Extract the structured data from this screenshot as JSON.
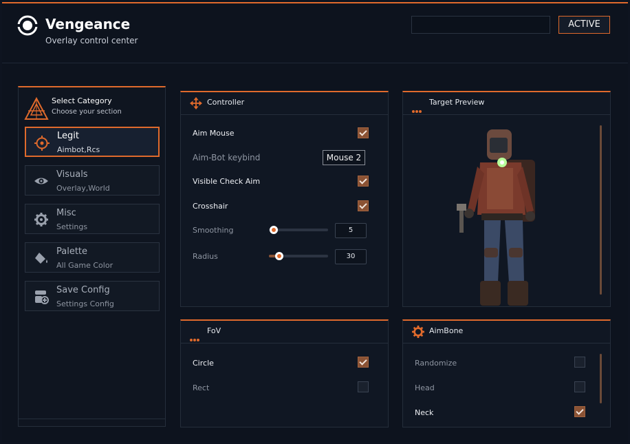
{
  "app": {
    "title": "Vengeance",
    "subtitle": "Overlay control center",
    "status": "ACTIVE",
    "accent": "#e06a2c"
  },
  "sidebar": {
    "title": "Select Category",
    "subtitle": "Choose your section",
    "items": [
      {
        "label": "Legit",
        "sub": "Aimbot,Rcs",
        "icon": "crosshair-icon",
        "active": true
      },
      {
        "label": "Visuals",
        "sub": "Overlay,World",
        "icon": "eye-icon",
        "active": false
      },
      {
        "label": "Misc",
        "sub": "Settings",
        "icon": "gear-icon",
        "active": false
      },
      {
        "label": "Palette",
        "sub": "All Game Color",
        "icon": "paint-bucket-icon",
        "active": false
      },
      {
        "label": "Save Config",
        "sub": "Settings Config",
        "icon": "save-config-icon",
        "active": false
      }
    ]
  },
  "controller": {
    "title": "Controller",
    "aim_mouse": {
      "label": "Aim Mouse",
      "checked": true
    },
    "keybind": {
      "label": "Aim-Bot keybind",
      "value": "Mouse 2"
    },
    "visible_check": {
      "label": "Visible Check Aim",
      "checked": true
    },
    "crosshair": {
      "label": "Crosshair",
      "checked": true
    },
    "smoothing": {
      "label": "Smoothing",
      "value": "5",
      "fraction": 0.05
    },
    "radius": {
      "label": "Radius",
      "value": "30",
      "fraction": 0.17
    }
  },
  "preview": {
    "title": "Target Preview"
  },
  "fov": {
    "title": "FoV",
    "options": [
      {
        "label": "Circle",
        "checked": true
      },
      {
        "label": "Rect",
        "checked": false
      }
    ]
  },
  "aimbone": {
    "title": "AimBone",
    "options": [
      {
        "label": "Randomize",
        "checked": false
      },
      {
        "label": "Head",
        "checked": false
      },
      {
        "label": "Neck",
        "checked": true
      }
    ]
  }
}
